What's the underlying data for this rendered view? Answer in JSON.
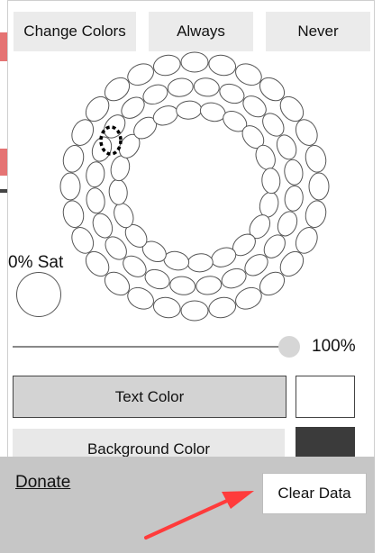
{
  "toolbar": {
    "change_colors": "Change Colors",
    "always": "Always",
    "never": "Never"
  },
  "saturation": {
    "label": "0% Sat"
  },
  "slider": {
    "value_text": "100%",
    "value": 1.0
  },
  "text_color": {
    "label": "Text Color",
    "swatch_color": "#ffffff"
  },
  "background_color": {
    "label": "Background Color",
    "swatch_color": "#3b3b3b"
  },
  "footer": {
    "donate": "Donate",
    "clear_data": "Clear Data"
  },
  "colors": {
    "annotation_arrow": "#ff3b3b",
    "footer_bg": "#c6c6c6"
  },
  "icons": {
    "color_wheel": "color-wheel-icon",
    "selected_cell": "selected-cell-marker-icon",
    "annotation": "red-arrow-icon"
  }
}
